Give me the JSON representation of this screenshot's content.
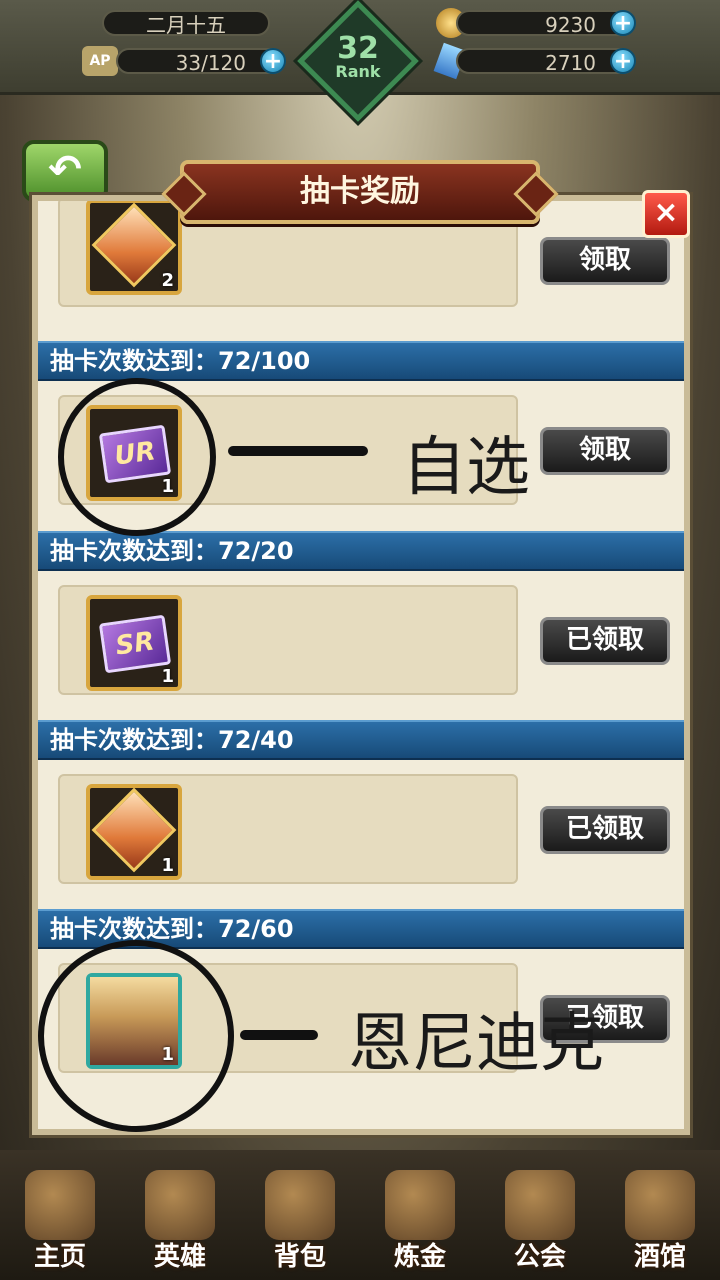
{
  "hud": {
    "date": "二月十五",
    "stamina": "33/120",
    "gold": "9230",
    "gems": "2710",
    "rank_number": "32",
    "rank_label": "Rank",
    "stamina_prefix": "AP"
  },
  "dialog": {
    "title": "抽卡奖励",
    "close_label": "×",
    "rows": [
      {
        "head": "",
        "count": "2",
        "button": "领取",
        "item": "gem"
      },
      {
        "head": "抽卡次数达到：72/100",
        "count": "1",
        "button": "领取",
        "item": "UR"
      },
      {
        "head": "抽卡次数达到：72/20",
        "count": "1",
        "button": "已领取",
        "item": "SR"
      },
      {
        "head": "抽卡次数达到：72/40",
        "count": "1",
        "button": "已领取",
        "item": "gem"
      },
      {
        "head": "抽卡次数达到：72/60",
        "count": "1",
        "button": "已领取",
        "item": "hero"
      }
    ]
  },
  "annotations": {
    "ur_note": "自选",
    "hero_note": "恩尼迪克"
  },
  "nav": [
    "主页",
    "英雄",
    "背包",
    "炼金",
    "公会",
    "酒馆"
  ],
  "colors": {
    "section_blue": "#1f5f94",
    "panel_bg": "#f2ecda",
    "title_red": "#6e2616",
    "close_red": "#d22a1e"
  }
}
